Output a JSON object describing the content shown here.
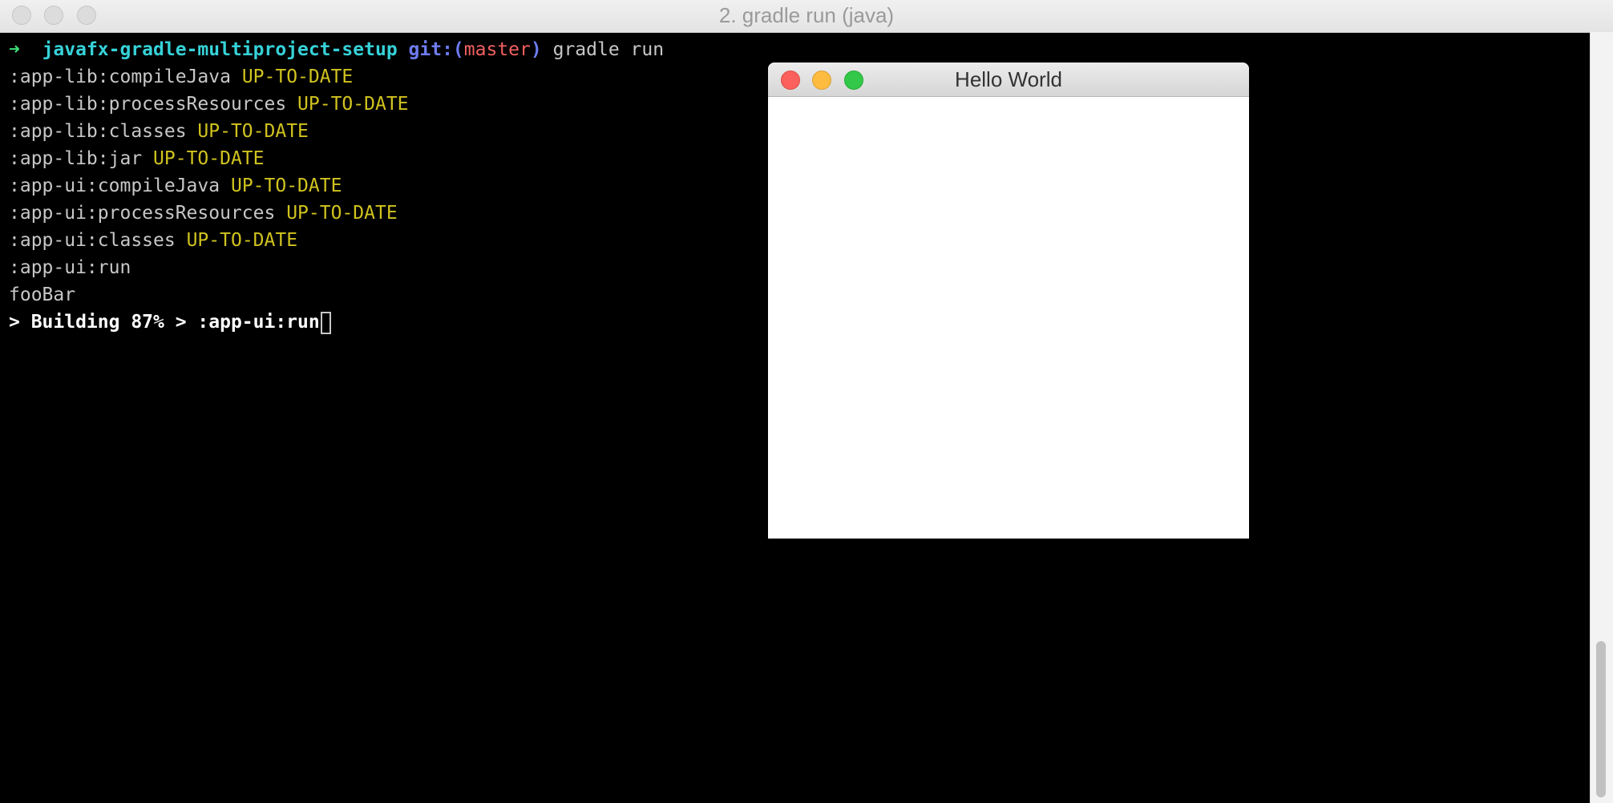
{
  "terminal": {
    "window_title": "2. gradle run (java)",
    "prompt": {
      "arrow": "➜",
      "directory": "javafx-gradle-multiproject-setup",
      "git_label": "git:(",
      "branch": "master",
      "git_close": ")",
      "command": "gradle run"
    },
    "lines": [
      {
        "task": ":app-lib:compileJava",
        "status": "UP-TO-DATE"
      },
      {
        "task": ":app-lib:processResources",
        "status": "UP-TO-DATE"
      },
      {
        "task": ":app-lib:classes",
        "status": "UP-TO-DATE"
      },
      {
        "task": ":app-lib:jar",
        "status": "UP-TO-DATE"
      },
      {
        "task": ":app-ui:compileJava",
        "status": "UP-TO-DATE"
      },
      {
        "task": ":app-ui:processResources",
        "status": "UP-TO-DATE"
      },
      {
        "task": ":app-ui:classes",
        "status": "UP-TO-DATE"
      },
      {
        "task": ":app-ui:run",
        "status": ""
      }
    ],
    "output": "fooBar",
    "progress": "> Building 87% > :app-ui:run"
  },
  "app_window": {
    "title": "Hello World"
  },
  "colors": {
    "close": "#fc605c",
    "minimize": "#fdbc40",
    "maximize": "#34c84a",
    "terminal_bg": "#000000",
    "status_yellow": "#d1c31f"
  }
}
